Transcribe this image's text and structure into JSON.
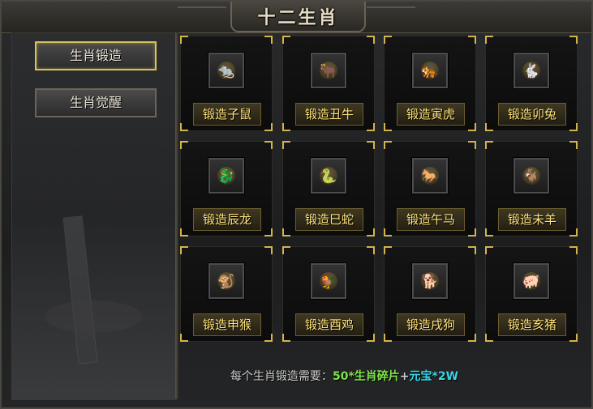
{
  "window": {
    "title": "十二生肖"
  },
  "sidebar": {
    "items": [
      {
        "label": "生肖锻造",
        "active": true
      },
      {
        "label": "生肖觉醒",
        "active": false
      }
    ]
  },
  "zodiacs": [
    {
      "label": "锻造子鼠",
      "icon": "rat-icon"
    },
    {
      "label": "锻造丑牛",
      "icon": "ox-icon"
    },
    {
      "label": "锻造寅虎",
      "icon": "tiger-icon"
    },
    {
      "label": "锻造卯兔",
      "icon": "rabbit-icon"
    },
    {
      "label": "锻造辰龙",
      "icon": "dragon-icon"
    },
    {
      "label": "锻造巳蛇",
      "icon": "snake-icon"
    },
    {
      "label": "锻造午马",
      "icon": "horse-icon"
    },
    {
      "label": "锻造未羊",
      "icon": "goat-icon"
    },
    {
      "label": "锻造申猴",
      "icon": "monkey-icon"
    },
    {
      "label": "锻造酉鸡",
      "icon": "rooster-icon"
    },
    {
      "label": "锻造戌狗",
      "icon": "dog-icon"
    },
    {
      "label": "锻造亥猪",
      "icon": "pig-icon"
    }
  ],
  "footer": {
    "label": "每个生肖锻造需要：",
    "shard_cost": "50*生肖碎片",
    "plus": "+",
    "gold_cost": "元宝*2W"
  },
  "colors": {
    "accent_gold": "#d4b44a",
    "button_text": "#ffe27a",
    "shard_green": "#7de34a",
    "gold_cyan": "#37d6ea"
  }
}
